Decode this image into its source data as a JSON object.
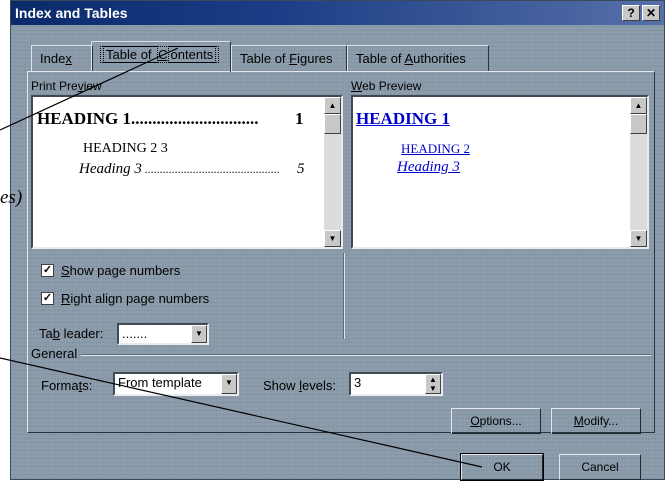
{
  "window": {
    "title": "Index and Tables",
    "help_label": "?",
    "close_label": "✕"
  },
  "tabs": [
    {
      "pre": "Inde",
      "acc": "x",
      "post": ""
    },
    {
      "pre": "Table of ",
      "acc": "C",
      "post": "ontents"
    },
    {
      "pre": "Table of ",
      "acc": "F",
      "post": "igures"
    },
    {
      "pre": "Table of ",
      "acc": "A",
      "post": "uthorities"
    }
  ],
  "print_preview": {
    "label_pre": "Print Pre",
    "label_acc": "v",
    "label_post": "iew",
    "heading1": "HEADING 1",
    "heading1_page": "1",
    "heading2": "HEADING 2 3",
    "heading3": "Heading 3",
    "heading3_page": "5"
  },
  "web_preview": {
    "label_pre": "",
    "label_acc": "W",
    "label_post": "eb Preview",
    "heading1": "HEADING 1",
    "heading2": "HEADING 2",
    "heading3": "Heading 3"
  },
  "options": {
    "show_page_numbers": {
      "pre": "",
      "acc": "S",
      "post": "how page numbers",
      "checked_mark": "✓"
    },
    "right_align": {
      "pre": "",
      "acc": "R",
      "post": "ight align page numbers",
      "checked_mark": "✓"
    },
    "tab_leader": {
      "label_pre": "Ta",
      "label_acc": "b",
      "label_post": " leader:",
      "value": "......."
    }
  },
  "general": {
    "label": "General",
    "formats_label_pre": "Forma",
    "formats_label_acc": "t",
    "formats_label_post": "s:",
    "formats_value": "From template",
    "levels_label_pre": "Show ",
    "levels_label_acc": "l",
    "levels_label_post": "evels:",
    "levels_value": "3"
  },
  "buttons": {
    "options": {
      "pre": "",
      "acc": "O",
      "post": "ptions..."
    },
    "modify": {
      "pre": "",
      "acc": "M",
      "post": "odify..."
    },
    "ok": "OK",
    "cancel": "Cancel"
  },
  "background_fragment": "es)",
  "colors": {
    "title_bar": "#0a2a6a",
    "dialog_bg": "#8a9aaa",
    "link": "#0000cc"
  }
}
